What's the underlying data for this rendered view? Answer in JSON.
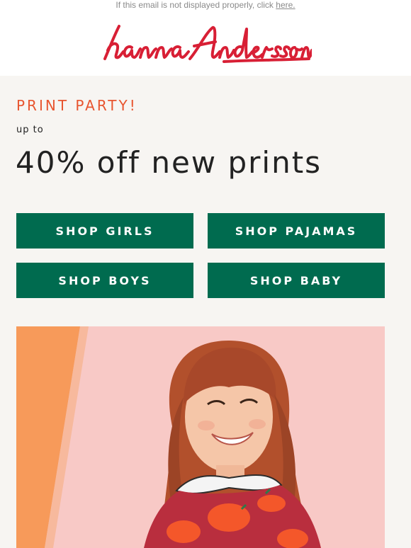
{
  "preheader": {
    "text": "If this email is not displayed properly, click",
    "link_label": "here."
  },
  "brand": {
    "logo_text": "hanna andersson",
    "color": "#d81f35"
  },
  "promo": {
    "eyebrow": "PRINT PARTY!",
    "prefix": "up to",
    "headline": "40% off new prints",
    "eyebrow_color": "#e8552f"
  },
  "buttons": {
    "girls": "SHOP GIRLS",
    "pajamas": "SHOP PAJAMAS",
    "boys": "SHOP BOYS",
    "baby": "SHOP BABY",
    "color": "#006b4f"
  },
  "hero_image": {
    "alt": "girl smiling in red print top"
  }
}
